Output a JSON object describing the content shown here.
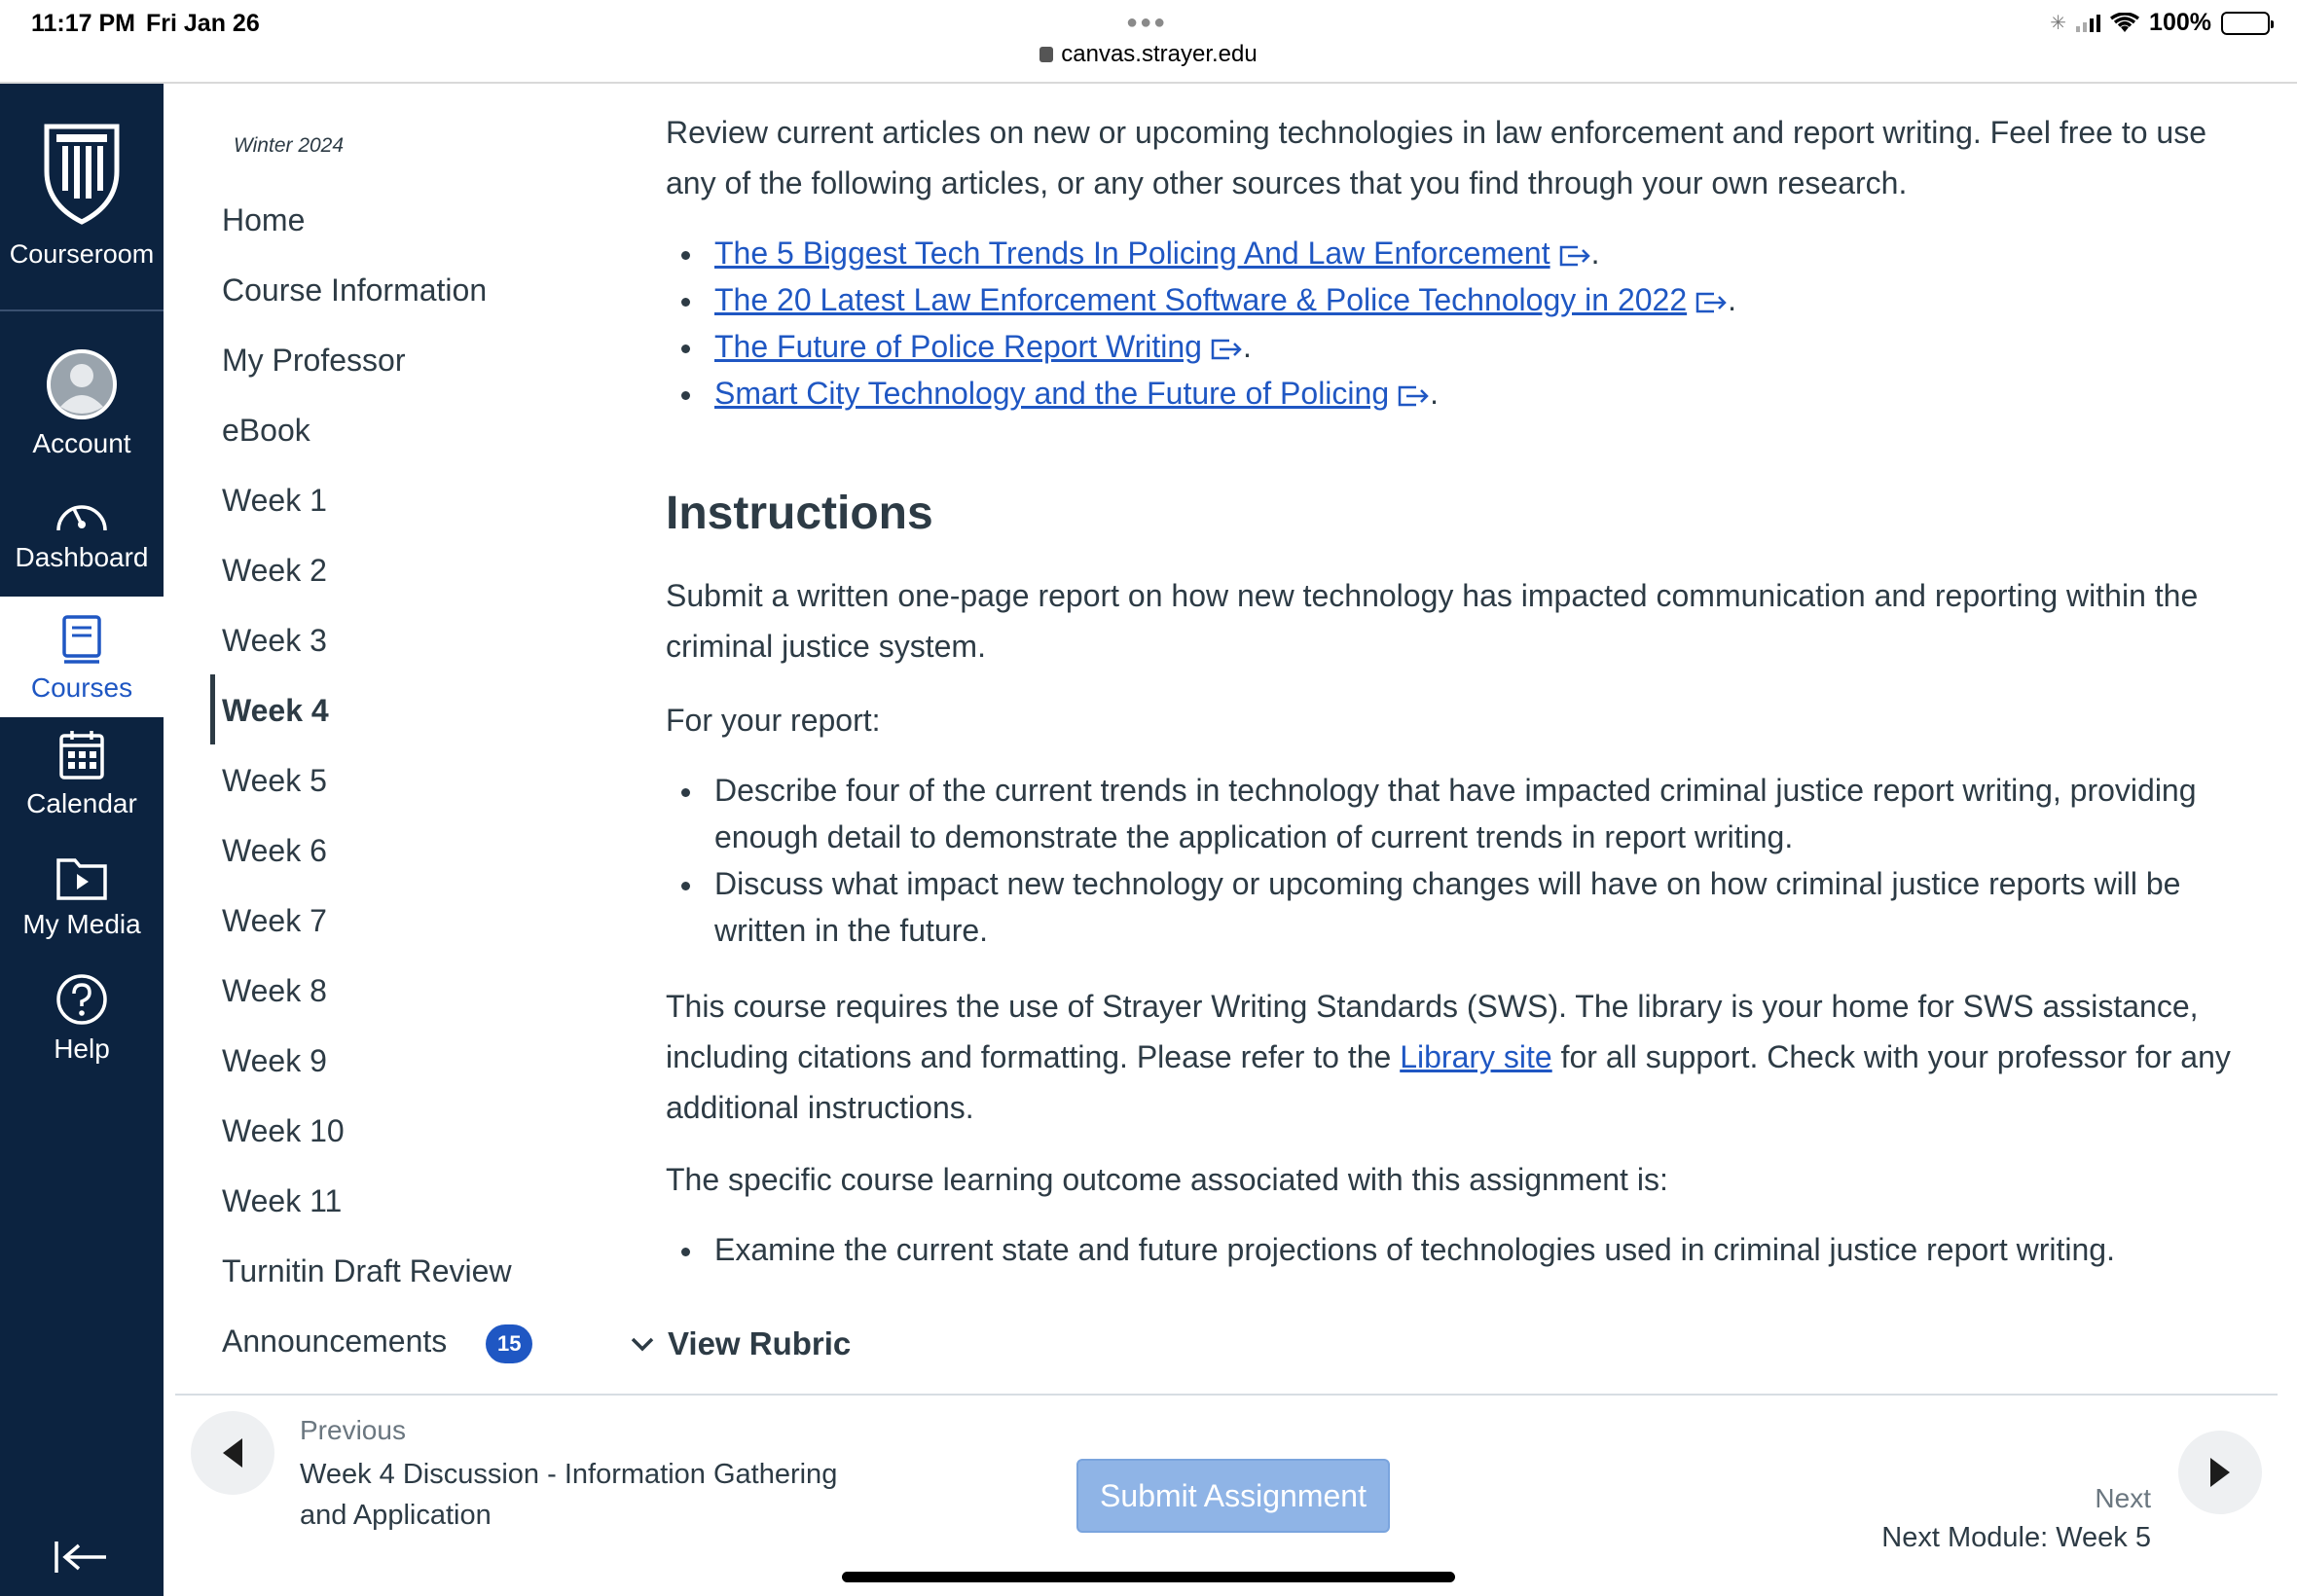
{
  "status_bar": {
    "time": "11:17 PM",
    "date": "Fri Jan 26",
    "url": "canvas.strayer.edu",
    "battery": "100%"
  },
  "global_nav": {
    "brand_label": "Courseroom",
    "items": [
      {
        "label": "Account",
        "icon": "avatar-icon"
      },
      {
        "label": "Dashboard",
        "icon": "dashboard-icon"
      },
      {
        "label": "Courses",
        "icon": "courses-icon",
        "active": true
      },
      {
        "label": "Calendar",
        "icon": "calendar-icon"
      },
      {
        "label": "My Media",
        "icon": "media-icon"
      },
      {
        "label": "Help",
        "icon": "help-icon"
      }
    ]
  },
  "course_nav": {
    "term": "Winter 2024",
    "items": [
      "Home",
      "Course Information",
      "My Professor",
      "eBook",
      "Week 1",
      "Week 2",
      "Week 3",
      "Week 4",
      "Week 5",
      "Week 6",
      "Week 7",
      "Week 8",
      "Week 9",
      "Week 10",
      "Week 11",
      "Turnitin Draft Review",
      "Announcements"
    ],
    "active_item": "Week 4",
    "announcements_badge": "15"
  },
  "content": {
    "intro": "Review current articles on new or upcoming technologies in law enforcement and report writing. Feel free to use any of the following articles, or any other sources that you find through your own research.",
    "links": [
      "The 5 Biggest Tech Trends In Policing And Law Enforcement",
      "The 20 Latest Law Enforcement Software & Police Technology in 2022",
      "The Future of Police Report Writing",
      "Smart City Technology and the Future of Policing"
    ],
    "instructions_heading": "Instructions",
    "instructions_para": "Submit a written one-page report on how new technology has impacted communication and reporting within the criminal justice system.",
    "for_report": "For your report:",
    "report_bullets": [
      "Describe four of the current trends in technology that have impacted criminal justice report writing, providing enough detail to demonstrate the application of current trends in report writing.",
      "Discuss what impact new technology or upcoming changes will have on how criminal justice reports will be written in the future."
    ],
    "sws_before": "This course requires the use of Strayer Writing Standards (SWS). The library is your home for SWS assistance, including citations and formatting. Please refer to the ",
    "sws_link": "Library site",
    "sws_after": " for all support. Check with your professor for any additional instructions.",
    "outcome_intro": "The specific course learning outcome associated with this assignment is:",
    "outcome_bullets": [
      "Examine the current state and future projections of technologies used in criminal justice report writing."
    ],
    "view_rubric": "View Rubric"
  },
  "footer": {
    "previous_label": "Previous",
    "previous_title": "Week 4 Discussion - Information Gathering and Application",
    "submit_label": "Submit Assignment",
    "next_label": "Next",
    "next_title": "Next Module: Week 5"
  },
  "colors": {
    "nav_bg": "#0c2340",
    "link": "#1f57c3",
    "submit_bg": "#8fb4e6",
    "text": "#2d3b45"
  }
}
